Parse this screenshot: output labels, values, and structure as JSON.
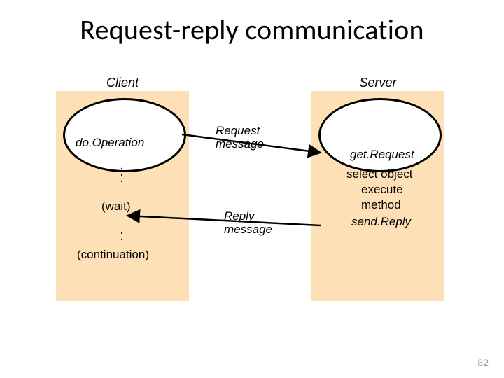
{
  "title": "Request-reply communication",
  "roles": {
    "client": "Client",
    "server": "Server"
  },
  "client": {
    "do_operation": "do.Operation",
    "wait": "(wait)",
    "continuation": "(continuation)"
  },
  "messages": {
    "request_l1": "Request",
    "request_l2": "message",
    "reply_l1": "Reply",
    "reply_l2": "message"
  },
  "server": {
    "get_request": "get.Request",
    "select_object": "select object",
    "execute": "execute",
    "method": "method",
    "send_reply": "send.Reply"
  },
  "page_number": "82"
}
